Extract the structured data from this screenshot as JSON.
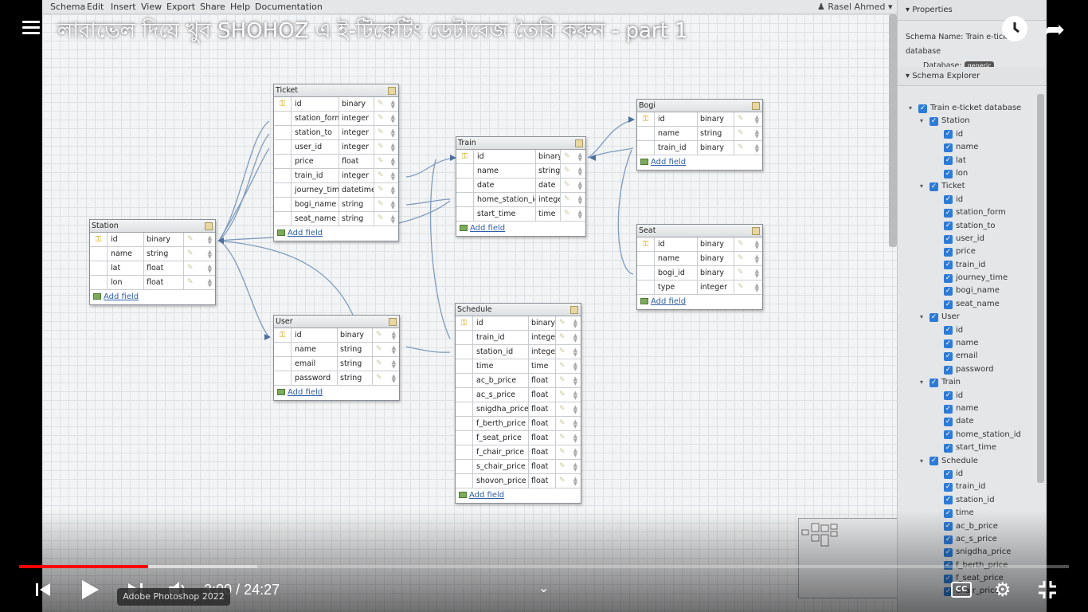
{
  "video": {
    "title": "লারাভেল দিয়ে খুব SHOHOZ এ ই-টিকেটিং ডেটাবেজ তৈরি করুন - part 1",
    "current_time": "3:00",
    "duration": "24:27",
    "time_sep": " / ",
    "progress": 0.123,
    "buffered": 0.227,
    "tooltip": "Adobe Photoshop 2022",
    "cc_label": "CC"
  },
  "app": {
    "menu": [
      "Schema",
      "Edit",
      "Insert",
      "View",
      "Export",
      "Share",
      "Help",
      "Documentation"
    ],
    "user": "Rasel Ahmed"
  },
  "tables": [
    {
      "name": "Ticket",
      "fields": [
        [
          "id",
          "binary"
        ],
        [
          "station_form",
          "integer"
        ],
        [
          "station_to",
          "integer"
        ],
        [
          "user_id",
          "integer"
        ],
        [
          "price",
          "float"
        ],
        [
          "train_id",
          "integer"
        ],
        [
          "journey_time",
          "datetime"
        ],
        [
          "bogi_name",
          "string"
        ],
        [
          "seat_name",
          "string"
        ]
      ]
    },
    {
      "name": "Station",
      "fields": [
        [
          "id",
          "binary"
        ],
        [
          "name",
          "string"
        ],
        [
          "lat",
          "float"
        ],
        [
          "lon",
          "float"
        ]
      ]
    },
    {
      "name": "Train",
      "fields": [
        [
          "id",
          "binary"
        ],
        [
          "name",
          "string"
        ],
        [
          "date",
          "date"
        ],
        [
          "home_station_id",
          "integer"
        ],
        [
          "start_time",
          "time"
        ]
      ]
    },
    {
      "name": "Bogi",
      "fields": [
        [
          "id",
          "binary"
        ],
        [
          "name",
          "string"
        ],
        [
          "train_id",
          "binary"
        ]
      ]
    },
    {
      "name": "Seat",
      "fields": [
        [
          "id",
          "binary"
        ],
        [
          "name",
          "binary"
        ],
        [
          "bogi_id",
          "binary"
        ],
        [
          "type",
          "integer"
        ]
      ]
    },
    {
      "name": "User",
      "fields": [
        [
          "id",
          "binary"
        ],
        [
          "name",
          "string"
        ],
        [
          "email",
          "string"
        ],
        [
          "password",
          "string"
        ]
      ]
    },
    {
      "name": "Schedule",
      "fields": [
        [
          "id",
          "binary"
        ],
        [
          "train_id",
          "integer"
        ],
        [
          "station_id",
          "integer"
        ],
        [
          "time",
          "time"
        ],
        [
          "ac_b_price",
          "float"
        ],
        [
          "ac_s_price",
          "float"
        ],
        [
          "snigdha_price",
          "float"
        ],
        [
          "f_berth_price",
          "float"
        ],
        [
          "f_seat_price",
          "float"
        ],
        [
          "f_chair_price",
          "float"
        ],
        [
          "s_chair_price",
          "float"
        ],
        [
          "shovon_price",
          "float"
        ]
      ]
    }
  ],
  "add_field_label": "Add field",
  "properties": {
    "header": "Properties",
    "schema_name_label": "Schema Name:",
    "schema_name_value": "Train e-ticket database",
    "database_label": "Database:",
    "database_value": "generic",
    "explorer_header": "Schema Explorer",
    "root": "Train e-ticket database",
    "tree": [
      {
        "name": "Station",
        "fields": [
          "id",
          "name",
          "lat",
          "lon"
        ]
      },
      {
        "name": "Ticket",
        "fields": [
          "id",
          "station_form",
          "station_to",
          "user_id",
          "price",
          "train_id",
          "journey_time",
          "bogi_name",
          "seat_name"
        ]
      },
      {
        "name": "User",
        "fields": [
          "id",
          "name",
          "email",
          "password"
        ]
      },
      {
        "name": "Train",
        "fields": [
          "id",
          "name",
          "date",
          "home_station_id",
          "start_time"
        ]
      },
      {
        "name": "Schedule",
        "fields": [
          "id",
          "train_id",
          "station_id",
          "time",
          "ac_b_price",
          "ac_s_price",
          "snigdha_price",
          "f_berth_price",
          "f_seat_price",
          "chair_price"
        ]
      }
    ]
  }
}
